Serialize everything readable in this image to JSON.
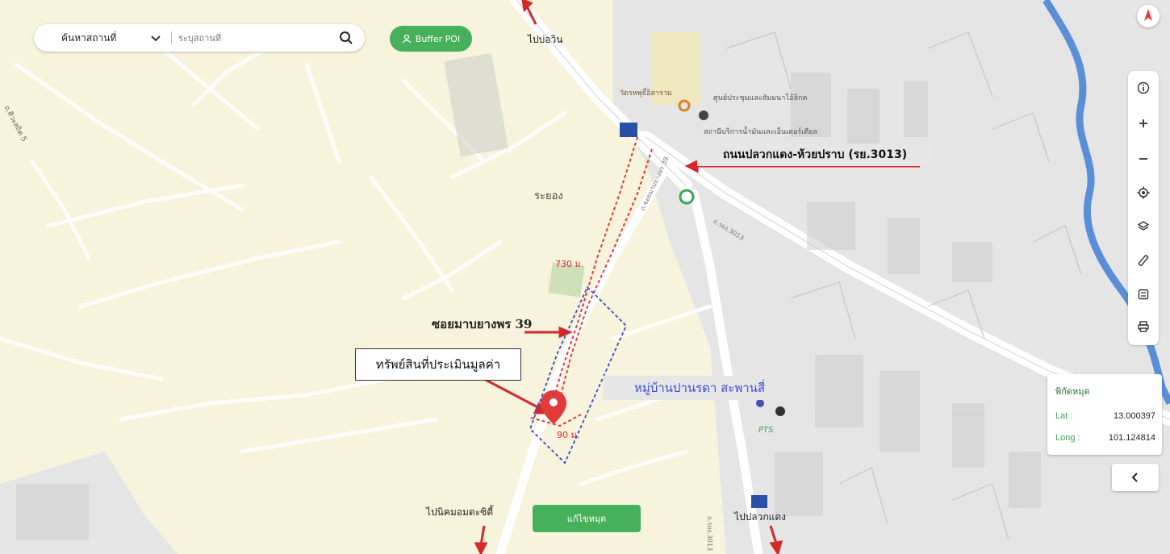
{
  "search": {
    "mode_label": "ค้นหาสถานที่",
    "placeholder": "ระบุสถานที่"
  },
  "buffer_button": {
    "label": "Buffer POI"
  },
  "toolbar": {
    "items": [
      "info-icon",
      "zoom-in-icon",
      "zoom-out-icon",
      "locate-icon",
      "layers-icon",
      "ruler-icon",
      "save-icon",
      "print-icon"
    ]
  },
  "coordinates": {
    "title": "พิกัดหมุด",
    "lat_label": "Lat :",
    "lat_value": "13.000397",
    "long_label": "Long :",
    "long_value": "101.124814"
  },
  "pin_button": {
    "label": "แก้ไขหมุด"
  },
  "map_labels": {
    "to_bowin": "ไปบ่อวิน",
    "to_nikhom": "ไปนิคมอมตะซิตี้",
    "to_plaukdaeng": "ไปปลวกแดง",
    "rayong": "ระยอง",
    "temple": "วัดรหพุธิ์อิสาราม",
    "center": "ศูนย์ประชุมและสัมมนาโอ้ลิกค",
    "office": "สถานีบริการน้ำมันและเอ็นเตอร์เตียล",
    "road_left": "ถ.ศิวะสถิต 5",
    "road_rg": "ถ.รยง.3013",
    "soi_small": "ถ.ซอยมาบยางพร 39",
    "road_bottom": "ถ.รยง.3013",
    "ptt": "PTS"
  },
  "annotations": {
    "road_name": "ถนนปลวกแดง-ห้วยปราบ (รย.3013)",
    "soi_name": "ซอยมาบยางพร 39",
    "asset": "ทรัพย์สินที่ประเมินมูลค่า",
    "village": "หมู่บ้านปานรดา สะพานสี่",
    "dist_730": "730 ม.",
    "dist_90": "90 ม."
  },
  "colors": {
    "map_bg": "#f7f3dc",
    "road": "#ffffff",
    "urban_bg": "#e4e4e4",
    "river": "#5a8fd8",
    "button_green": "#47b05a",
    "arrow_red": "#d62828",
    "route_red": "#e03a3a",
    "boundary_blue": "#3b48d6"
  }
}
